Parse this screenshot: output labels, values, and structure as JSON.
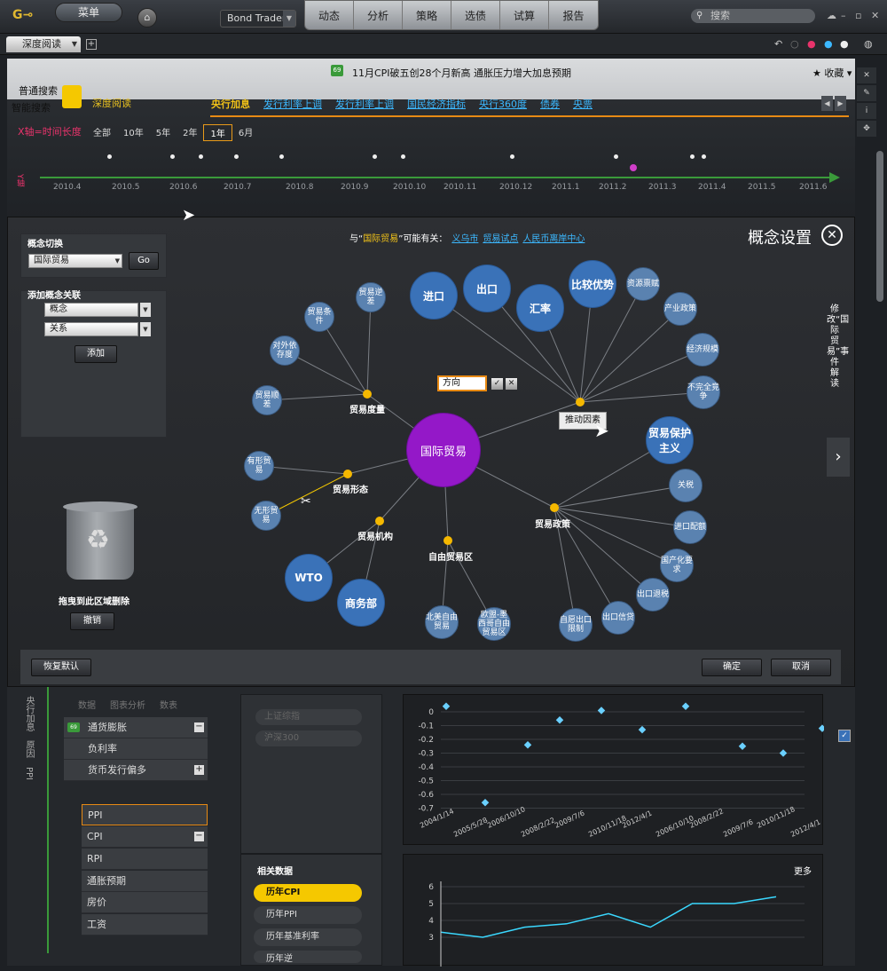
{
  "topbar": {
    "logo": "G",
    "menu": "菜单",
    "home_icon": "home-icon",
    "product": "Bond Trader",
    "tabs": [
      "动态",
      "分析",
      "策略",
      "选债",
      "试算",
      "报告"
    ],
    "search_placeholder": "搜索",
    "window_icons": [
      "feedback-icon",
      "minimize-icon",
      "restore-icon",
      "close-icon"
    ]
  },
  "tabbar": {
    "doc_tab": "深度阅读",
    "add_icon": "add-tab-icon",
    "nav_icons": [
      "back-icon",
      "refresh-icon",
      "pin-red-icon",
      "pin-blue-icon",
      "pin-white-icon",
      "globe-icon"
    ]
  },
  "banner": {
    "news": "11月CPI破五创28个月新高 通胀压力增大加息预期",
    "fav": "收藏"
  },
  "modes": {
    "normal": "普通搜索",
    "smart": "智能搜索",
    "deep": "深度阅读"
  },
  "related_tabs": [
    {
      "label": "央行加息",
      "active": true
    },
    {
      "label": "发行利率上调",
      "active": false
    },
    {
      "label": "发行利率上调",
      "active": false
    },
    {
      "label": "国民经济指标",
      "active": false
    },
    {
      "label": "央行360度",
      "active": false
    },
    {
      "label": "债券",
      "active": false
    },
    {
      "label": "央票",
      "active": false
    }
  ],
  "timeline": {
    "x_label": "X轴=时间长度",
    "y_label": "Y轴",
    "ranges": [
      {
        "label": "全部",
        "active": false
      },
      {
        "label": "10年",
        "active": false
      },
      {
        "label": "5年",
        "active": false
      },
      {
        "label": "2年",
        "active": false
      },
      {
        "label": "1年",
        "active": true
      },
      {
        "label": "6月",
        "active": false
      }
    ],
    "ticks": [
      "2010.4",
      "2010.5",
      "2010.6",
      "2010.7",
      "2010.8",
      "2010.9",
      "2010.10",
      "2010.11",
      "2010.12",
      "2011.1",
      "2011.2",
      "2011.3",
      "2011.4",
      "2011.5",
      "2011.6"
    ]
  },
  "modal": {
    "title": "概念设置",
    "related_prefix": "与“",
    "related_keyword": "国际贸易",
    "related_suffix": "”可能有关：",
    "related_links": [
      "义乌市",
      "贸易试点",
      "人民币离岸中心"
    ],
    "switch_title": "概念切换",
    "switch_value": "国际贸易",
    "go": "Go",
    "add_title": "添加概念关联",
    "concept_placeholder": "概念",
    "relation_placeholder": "关系",
    "add_btn": "添加",
    "trash_label": "拖曳到此区域删除",
    "undo": "撤销",
    "reset": "恢复默认",
    "ok": "确定",
    "cancel": "取消",
    "right_vertical": "修改“国际贸易”事件解读",
    "edit_value": "方向",
    "tooltip": "推动因素",
    "graph": {
      "center": "国际贸易",
      "hubs": [
        "贸易度量",
        "贸易形态",
        "贸易机构",
        "自由贸易区",
        "贸易政策",
        "推动因素"
      ],
      "nodes": [
        "贸易条件",
        "贸易逆差",
        "对外依存度",
        "贸易顺差",
        "有形贸易",
        "无形贸易",
        "WTO",
        "商务部",
        "北美自由贸易",
        "欧盟-墨西哥自由贸易区",
        "进口",
        "出口",
        "汇率",
        "比较优势",
        "资源禀赋",
        "产业政策",
        "经济规模",
        "不完全竞争",
        "贸易保护主义",
        "关税",
        "进口配额",
        "国产化要求",
        "出口退税",
        "出口信贷",
        "自愿出口限制"
      ]
    }
  },
  "bottom": {
    "subtabs": [
      "数据",
      "图表分析",
      "数表"
    ],
    "left_vertical": [
      "央行加息",
      "原因",
      "PPI"
    ],
    "tree": [
      {
        "label": "通货膨胀",
        "indent": 0
      },
      {
        "label": "负利率",
        "indent": 0
      },
      {
        "label": "货币发行偏多",
        "indent": 0
      }
    ],
    "list": [
      "PPI",
      "CPI",
      "RPI",
      "通胀预期",
      "房价",
      "工资"
    ],
    "indices": [
      "上证综指",
      "沪深300"
    ],
    "related_title": "相关数据",
    "more": "更多",
    "related_items": [
      {
        "label": "历年CPI",
        "active": true
      },
      {
        "label": "历年PPI",
        "active": false
      },
      {
        "label": "历年基准利率",
        "active": false
      },
      {
        "label": "历年逆",
        "active": false
      }
    ],
    "scatter": {
      "y_ticks": [
        "0",
        "-0.1",
        "-0.2",
        "-0.3",
        "-0.4",
        "-0.5",
        "-0.6",
        "-0.7"
      ],
      "x_ticks": [
        "2004/1/14",
        "2005/5/28",
        "2006/10/10",
        "2008/2/22",
        "2009/7/6",
        "2010/11/18",
        "2012/4/1",
        "2006/10/10",
        "2008/2/22",
        "2009/7/6",
        "2010/11/18",
        "2012/4/1"
      ],
      "points": [
        0.04,
        -0.66,
        -0.24,
        -0.06,
        0.01,
        -0.13,
        0.04,
        -0.25,
        -0.3,
        -0.12
      ]
    },
    "line": {
      "y_ticks": [
        "6",
        "5",
        "4",
        "3"
      ],
      "values": [
        3.3,
        3.0,
        3.6,
        3.8,
        4.4,
        3.6,
        5.0,
        5.0,
        5.4
      ]
    }
  }
}
